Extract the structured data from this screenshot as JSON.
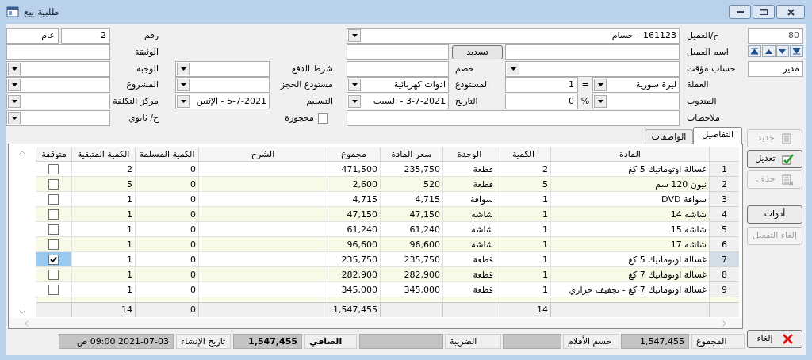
{
  "window": {
    "title": "طلبية بيع"
  },
  "record": {
    "number": "80",
    "user": "مدير"
  },
  "form": {
    "rows": [
      {
        "cells": [
          {
            "kind": "label",
            "text": "ح/العميل"
          },
          {
            "kind": "combo",
            "text": "161123 – حسام"
          },
          "",
          "",
          {
            "kind": "label",
            "text": "رقم"
          },
          {
            "kind": "text",
            "text": "2"
          },
          {
            "kind": "text",
            "text": "عام"
          }
        ]
      },
      {
        "cells": [
          {
            "kind": "label",
            "text": "اسم العميل"
          },
          {
            "kind": "text"
          },
          {
            "kind": "button",
            "text": "تسديد"
          },
          {
            "kind": "text"
          },
          "",
          "",
          {
            "kind": "label",
            "text": "الوثيقة"
          },
          {
            "kind": "text"
          }
        ]
      },
      {
        "cells": [
          {
            "kind": "label",
            "text": "حساب مؤقت"
          },
          {
            "kind": "combo"
          },
          {
            "kind": "label",
            "text": "خصم"
          },
          {
            "kind": "text"
          },
          {
            "kind": "label",
            "text": "شرط الدفع"
          },
          {
            "kind": "combo"
          },
          {
            "kind": "label",
            "text": "الوجبة"
          },
          {
            "kind": "combo"
          }
        ]
      },
      {
        "cells": [
          {
            "kind": "label",
            "text": "العملة"
          },
          {
            "kind": "combo",
            "text": "ليرة سورية"
          },
          {
            "kind": "symbol",
            "text": "="
          },
          {
            "kind": "text",
            "text": "1"
          },
          {
            "kind": "label",
            "text": "المستودع"
          },
          {
            "kind": "combo",
            "text": "ادوات كهربائية"
          },
          {
            "kind": "label",
            "text": "مستودع الحجز"
          },
          {
            "kind": "combo"
          },
          {
            "kind": "label",
            "text": "المشروع"
          },
          {
            "kind": "combo"
          }
        ]
      },
      {
        "cells": [
          {
            "kind": "label",
            "text": "المندوب"
          },
          {
            "kind": "combo"
          },
          {
            "kind": "symbol",
            "text": "%"
          },
          {
            "kind": "text",
            "text": "0"
          },
          {
            "kind": "label",
            "text": "التاريخ"
          },
          {
            "kind": "combo",
            "text": "3-7-2021 - السبت"
          },
          {
            "kind": "label",
            "text": "التسليم"
          },
          {
            "kind": "combo",
            "text": "5-7-2021 - الإثنين"
          },
          {
            "kind": "label",
            "text": "مركز التكلفة"
          },
          {
            "kind": "combo"
          }
        ]
      },
      {
        "cells": [
          {
            "kind": "label",
            "text": "ملاحظات"
          },
          {
            "kind": "text"
          },
          {
            "kind": "checkbox",
            "text": "محجوزة",
            "checked": false
          },
          "",
          {
            "kind": "label",
            "text": "ح/ ثانوي"
          },
          {
            "kind": "combo"
          }
        ]
      }
    ]
  },
  "tabs": [
    {
      "label": "التفاصيل",
      "selected": true
    },
    {
      "label": "الواصفات",
      "selected": false
    }
  ],
  "table": {
    "columns": [
      "المادة",
      "الكمية",
      "الوحدة",
      "سعر المادة",
      "مجموع",
      "الشرح",
      "الكمية المسلمة",
      "الكمية المتبقية",
      "متوقفة"
    ],
    "rows": [
      {
        "number": "1",
        "material": "غسالة اوتوماتيك 5 كغ",
        "quantity": "2",
        "unit": "قطعة",
        "price": "235,750",
        "total": "471,500",
        "delivered": "0",
        "remaining": "2",
        "stopped": false,
        "selected": false
      },
      {
        "number": "2",
        "material": "نيون 120 سم",
        "quantity": "5",
        "unit": "قطعة",
        "price": "520",
        "total": "2,600",
        "delivered": "0",
        "remaining": "5",
        "stopped": false,
        "selected": false
      },
      {
        "number": "3",
        "material": "سواقة DVD",
        "quantity": "1",
        "unit": "سواقة",
        "price": "4,715",
        "total": "4,715",
        "delivered": "0",
        "remaining": "1",
        "stopped": false,
        "selected": false
      },
      {
        "number": "4",
        "material": "شاشة 14",
        "quantity": "1",
        "unit": "شاشة",
        "price": "47,150",
        "total": "47,150",
        "delivered": "0",
        "remaining": "1",
        "stopped": false,
        "selected": false
      },
      {
        "number": "5",
        "material": "شاشة 15",
        "quantity": "1",
        "unit": "شاشة",
        "price": "61,240",
        "total": "61,240",
        "delivered": "0",
        "remaining": "1",
        "stopped": false,
        "selected": false
      },
      {
        "number": "6",
        "material": "شاشة 17",
        "quantity": "1",
        "unit": "شاشة",
        "price": "96,600",
        "total": "96,600",
        "delivered": "0",
        "remaining": "1",
        "stopped": false,
        "selected": false
      },
      {
        "number": "7",
        "material": "غسالة اوتوماتيك 5 كغ",
        "quantity": "1",
        "unit": "قطعة",
        "price": "235,750",
        "total": "235,750",
        "delivered": "0",
        "remaining": "1",
        "stopped": true,
        "selected": true
      },
      {
        "number": "8",
        "material": "غسالة اوتوماتيك 7 كغ",
        "quantity": "1",
        "unit": "قطعة",
        "price": "282,900",
        "total": "282,900",
        "delivered": "0",
        "remaining": "1",
        "stopped": false,
        "selected": false
      },
      {
        "number": "9",
        "material": "غسالة اوتوماتيك 7 كغ - تجفيف حراري",
        "quantity": "1",
        "unit": "قطعة",
        "price": "345,000",
        "total": "345,000",
        "delivered": "0",
        "remaining": "1",
        "stopped": false,
        "selected": false
      }
    ],
    "totals": {
      "quantity": "14",
      "total": "1,547,455",
      "delivered": "0",
      "remaining": "14"
    }
  },
  "side_buttons": [
    {
      "label": "جديد",
      "disabled": true
    },
    {
      "label": "تعديل",
      "disabled": false
    },
    {
      "label": "حذف",
      "disabled": true
    },
    {
      "label": "أدوات",
      "disabled": false
    },
    {
      "label": "إلغاء التفعيل",
      "disabled": true
    }
  ],
  "cancel_button": {
    "label": "إلغاء"
  },
  "status_bar": [
    {
      "kind": "label",
      "text": "المجموع",
      "emphasis": false
    },
    {
      "kind": "value",
      "text": "1,547,455",
      "emphasis": false
    },
    {
      "kind": "label",
      "text": "حسم الأقلام",
      "emphasis": false
    },
    {
      "kind": "value"
    },
    {
      "kind": "label",
      "text": "الضريبة",
      "emphasis": false
    },
    {
      "kind": "value"
    },
    {
      "kind": "label",
      "text": "الصافي",
      "emphasis": true
    },
    {
      "kind": "value",
      "text": "1,547,455",
      "emphasis": true
    },
    {
      "kind": "label",
      "text": "تاريخ الإنشاء",
      "emphasis": false
    },
    {
      "kind": "value",
      "text": "2021-07-03 09:00 ص",
      "emphasis": false
    }
  ]
}
